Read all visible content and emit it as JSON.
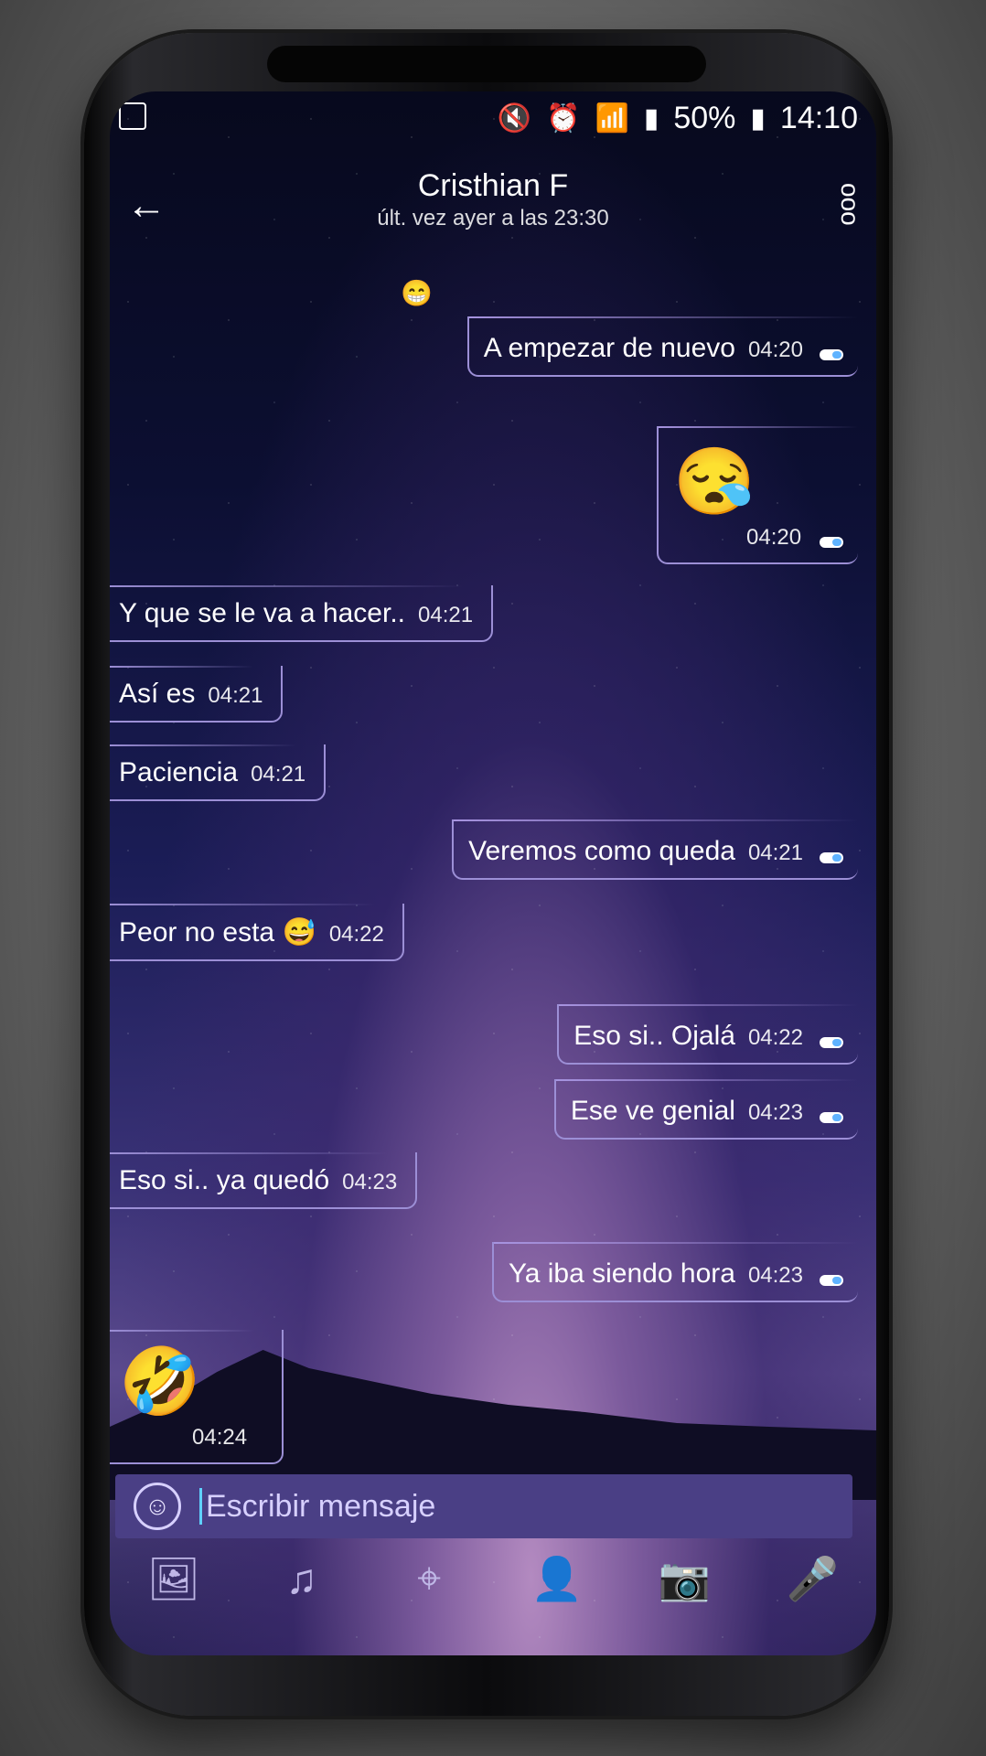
{
  "status_bar": {
    "battery": "50%",
    "time": "14:10",
    "icons": [
      "image-icon",
      "mute-icon",
      "alarm-icon",
      "wifi-icon",
      "signal-icon",
      "battery-icon"
    ]
  },
  "header": {
    "back_icon": "back-arrow-icon",
    "title": "Cristhian F",
    "subtitle": "últ. vez ayer a las 23:30",
    "more_icon": "more-options-icon"
  },
  "messages": [
    {
      "dir": "out",
      "text": "A empezar de nuevo",
      "time": "04:20"
    },
    {
      "dir": "out",
      "emoji": "😪",
      "time": "04:20"
    },
    {
      "dir": "in",
      "text": "Y que se le va a hacer..",
      "time": "04:21"
    },
    {
      "dir": "in",
      "text": "Así es",
      "time": "04:21"
    },
    {
      "dir": "in",
      "text": "Paciencia",
      "time": "04:21"
    },
    {
      "dir": "out",
      "text": "Veremos como queda",
      "time": "04:21"
    },
    {
      "dir": "in",
      "text": "Peor no esta 😅",
      "time": "04:22"
    },
    {
      "dir": "out",
      "text": "Eso si.. Ojalá",
      "time": "04:22"
    },
    {
      "dir": "out",
      "text": "Ese ve genial",
      "time": "04:23"
    },
    {
      "dir": "in",
      "text": "Eso si.. ya quedó",
      "time": "04:23"
    },
    {
      "dir": "out",
      "text": "Ya iba siendo hora",
      "time": "04:23"
    },
    {
      "dir": "in",
      "emoji": "🤣",
      "time": "04:24"
    }
  ],
  "top_emoji": "😁",
  "input": {
    "placeholder": "Escribir mensaje"
  },
  "toolbar": [
    "gallery-icon",
    "music-icon",
    "location-icon",
    "contact-icon",
    "camera-icon",
    "microphone-icon"
  ],
  "colors": {
    "accent": "#4a3f85",
    "tick": "#5fb3ff",
    "mic": "#e03a3a"
  }
}
